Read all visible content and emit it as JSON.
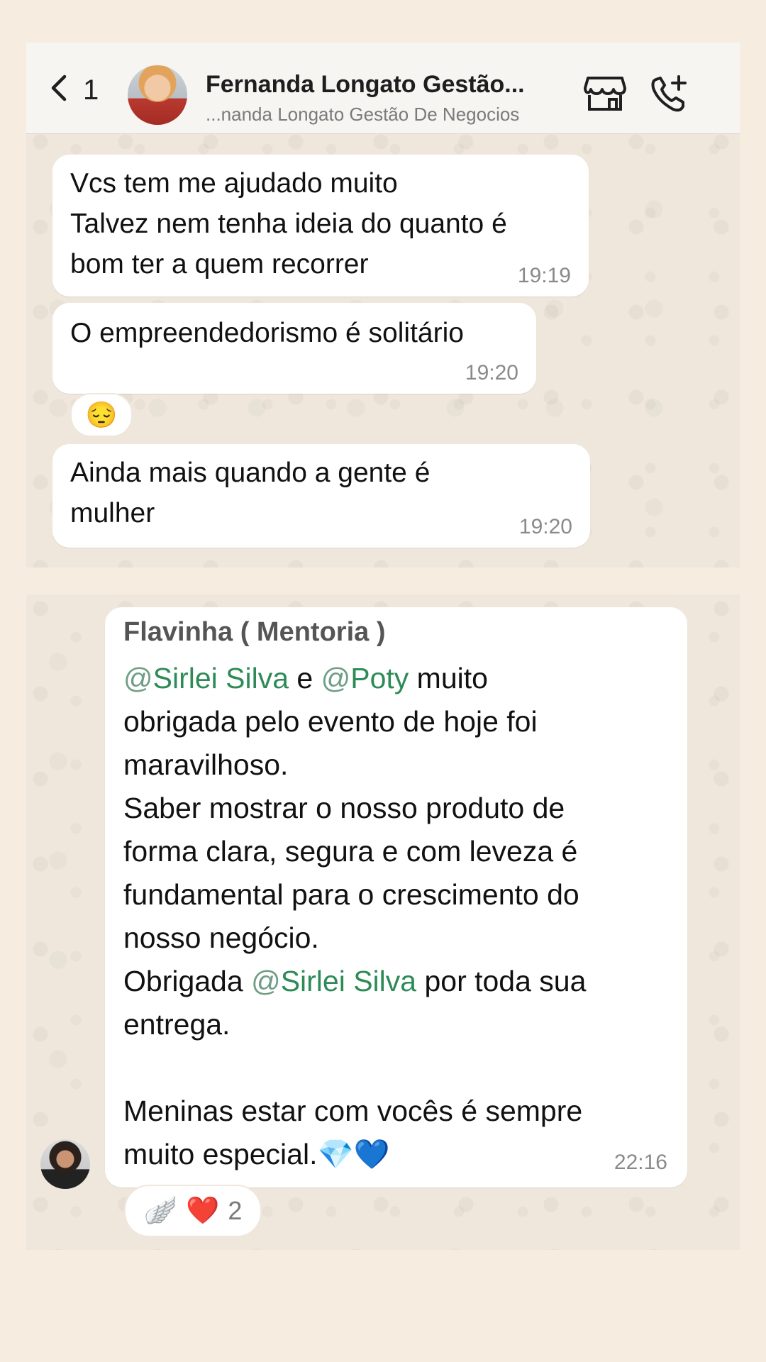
{
  "header": {
    "back_count": "1",
    "title": "Fernanda Longato Gestão...",
    "subtitle": "...nanda Longato Gestão De Negocios"
  },
  "messages_top": [
    {
      "text": "Vcs tem me ajudado muito\nTalvez nem tenha ideia do quanto é\nbom ter a quem recorrer",
      "time": "19:19"
    },
    {
      "text": "O empreendedorismo é solitário",
      "time": "19:20"
    },
    {
      "text": "Ainda mais quando a gente é\nmulher",
      "time": "19:20"
    }
  ],
  "reaction_top": {
    "emoji": "😔"
  },
  "group_message": {
    "sender": "Flavinha ( Mentoria )",
    "mention_1": "Sirlei Silva",
    "mention_2": "Poty",
    "mention_3": "Sirlei Silva",
    "at": "@",
    "part_e": " e ",
    "part_1": " muito\nobrigada pelo evento de hoje foi\nmaravilhoso.\nSaber mostrar o nosso produto de\nforma clara, segura e com leveza é\nfundamental para o crescimento do\nnosso negócio.\nObrigada ",
    "part_2": " por toda sua\nentrega.\n\nMeninas estar com vocês é sempre\nmuito especial.💎💙",
    "time": "22:16"
  },
  "reactions_bottom": {
    "emoji_1": "🪽",
    "emoji_2": "❤️",
    "count": "2"
  }
}
